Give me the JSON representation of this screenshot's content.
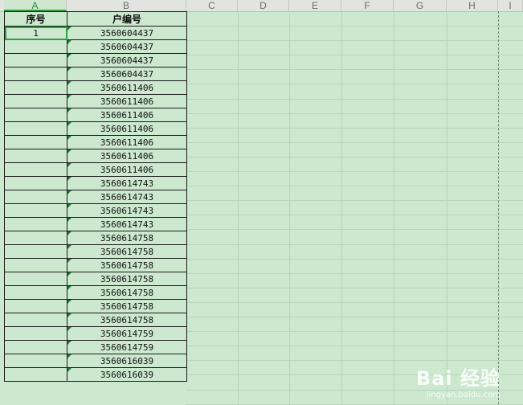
{
  "column_headers": [
    "A",
    "B",
    "C",
    "D",
    "E",
    "F",
    "G",
    "H",
    "I"
  ],
  "table": {
    "headers": [
      "序号",
      "户编号"
    ],
    "rows": [
      [
        "1",
        "3560604437"
      ],
      [
        "",
        "3560604437"
      ],
      [
        "",
        "3560604437"
      ],
      [
        "",
        "3560604437"
      ],
      [
        "",
        "3560611406"
      ],
      [
        "",
        "3560611406"
      ],
      [
        "",
        "3560611406"
      ],
      [
        "",
        "3560611406"
      ],
      [
        "",
        "3560611406"
      ],
      [
        "",
        "3560611406"
      ],
      [
        "",
        "3560611406"
      ],
      [
        "",
        "3560614743"
      ],
      [
        "",
        "3560614743"
      ],
      [
        "",
        "3560614743"
      ],
      [
        "",
        "3560614743"
      ],
      [
        "",
        "3560614758"
      ],
      [
        "",
        "3560614758"
      ],
      [
        "",
        "3560614758"
      ],
      [
        "",
        "3560614758"
      ],
      [
        "",
        "3560614758"
      ],
      [
        "",
        "3560614758"
      ],
      [
        "",
        "3560614758"
      ],
      [
        "",
        "3560614759"
      ],
      [
        "",
        "3560614759"
      ],
      [
        "",
        "3560616039"
      ],
      [
        "",
        "3560616039"
      ]
    ]
  },
  "watermark": {
    "title": "Bai 经验",
    "url": "jingyan.baidu.com"
  },
  "colors": {
    "sheet_bg": "#cce8cf",
    "selection": "#2f9e44",
    "header_bg": "#e2e4e2"
  }
}
